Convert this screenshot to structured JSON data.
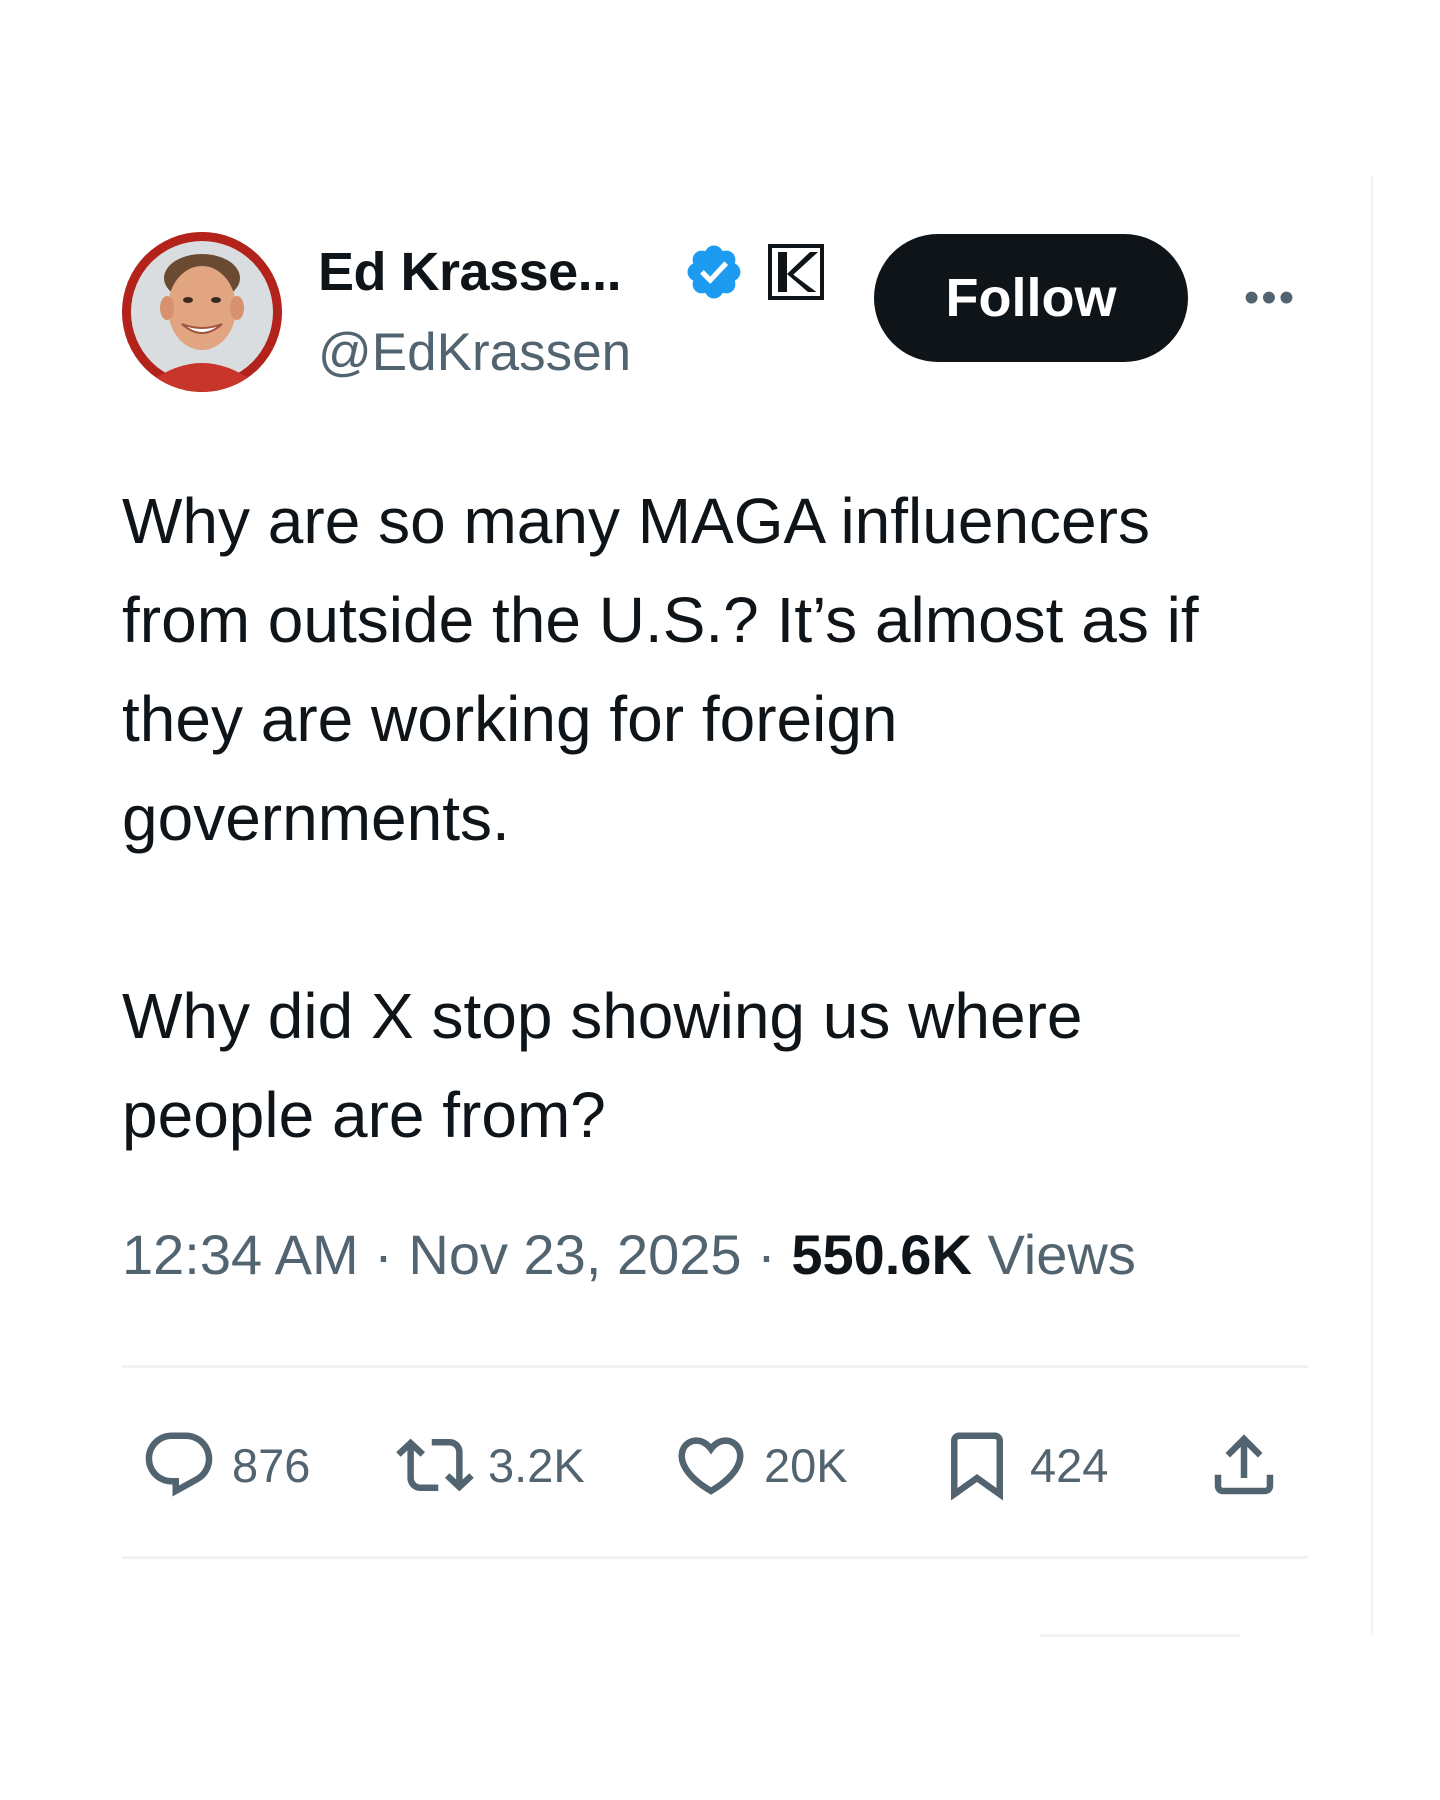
{
  "tweet": {
    "author": {
      "display_name": "Ed Krasse...",
      "handle": "@EdKrassen",
      "verified": true,
      "verified_color": "#1d9bf0",
      "affiliation_badge_icon": "k-affiliate-badge-icon"
    },
    "follow_label": "Follow",
    "more_icon": "more-options-icon",
    "body": [
      "Why are so many MAGA influencers from outside the U.S.? It’s almost as if they are working for foreign governments.",
      "Why did X stop showing us where people are from?"
    ],
    "meta": {
      "time": "12:34 AM",
      "separator": "·",
      "date": "Nov 23, 2025",
      "views_count": "550.6K",
      "views_label": "Views"
    },
    "actions": {
      "replies": {
        "icon": "reply-icon",
        "count": "876"
      },
      "reposts": {
        "icon": "repost-icon",
        "count": "3.2K"
      },
      "likes": {
        "icon": "heart-icon",
        "count": "20K"
      },
      "bookmarks": {
        "icon": "bookmark-icon",
        "count": "424"
      },
      "share": {
        "icon": "share-icon"
      }
    }
  },
  "colors": {
    "text_primary": "#0f1419",
    "text_secondary": "#536471",
    "follow_bg": "#0f1419",
    "divider": "#eff3f4",
    "avatar_ring": "#b3231c"
  }
}
